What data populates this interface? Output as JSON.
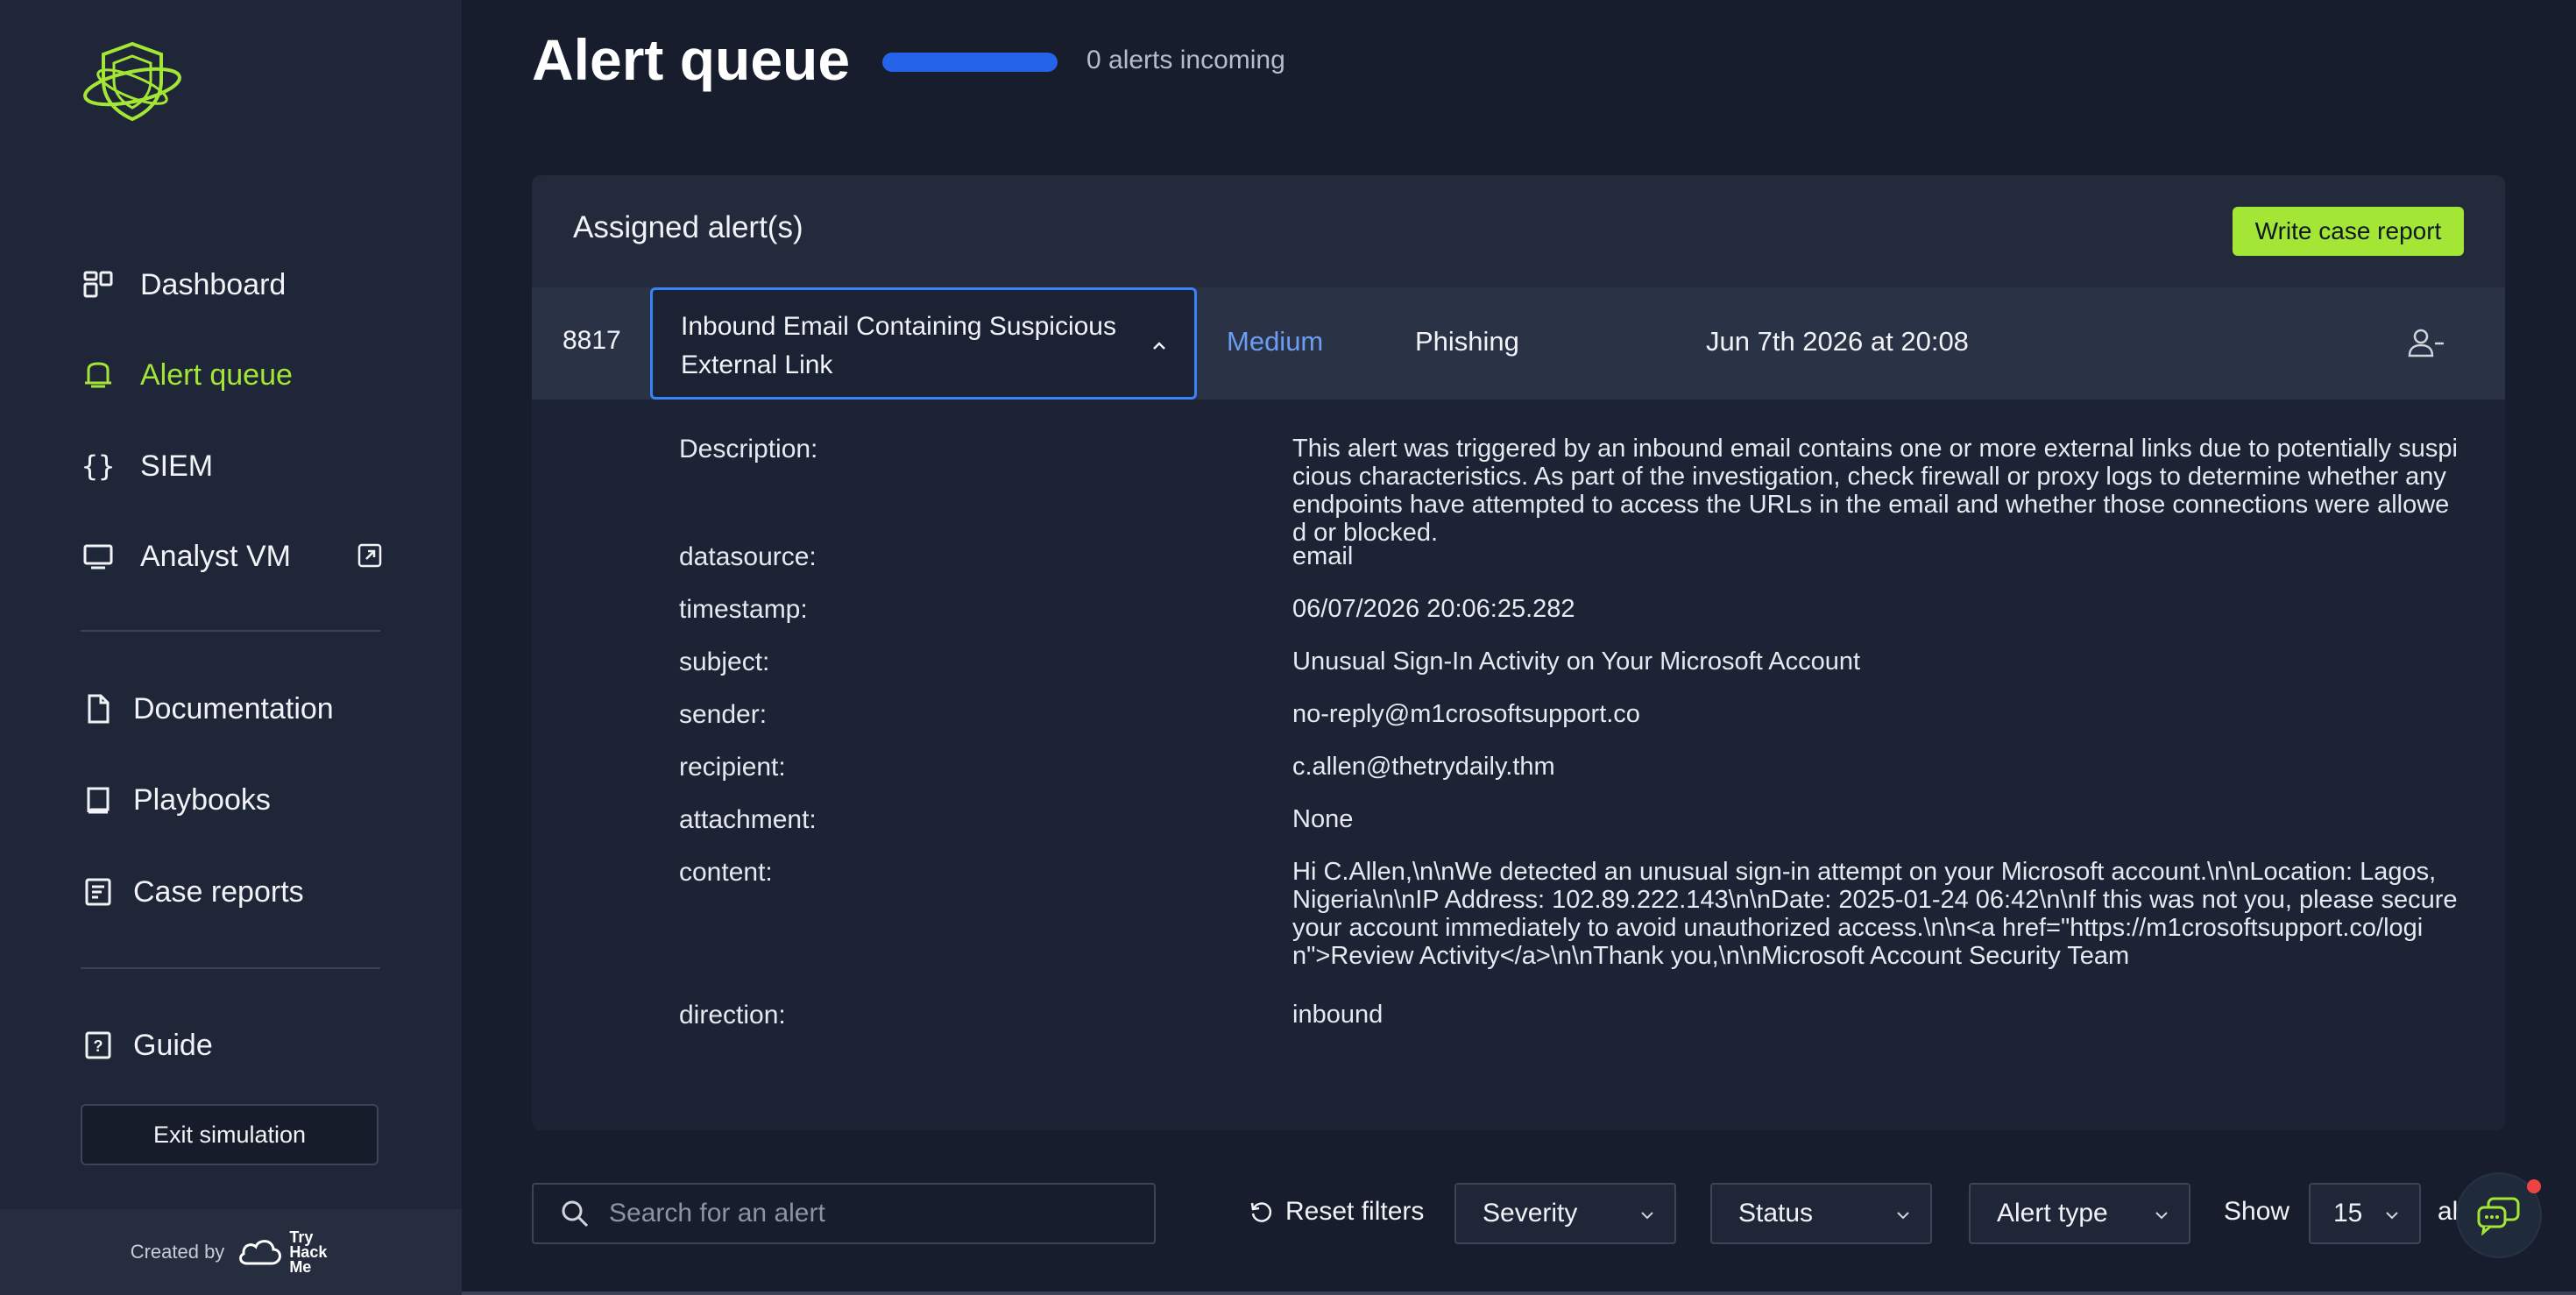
{
  "sidebar": {
    "nav": [
      {
        "label": "Dashboard",
        "icon": "dashboard-icon"
      },
      {
        "label": "Alert queue",
        "icon": "alert-queue-icon",
        "active": true
      },
      {
        "label": "SIEM",
        "icon": "braces-icon"
      },
      {
        "label": "Analyst VM",
        "icon": "monitor-icon"
      }
    ],
    "resources": [
      {
        "label": "Documentation",
        "icon": "document-icon"
      },
      {
        "label": "Playbooks",
        "icon": "book-icon"
      },
      {
        "label": "Case reports",
        "icon": "case-report-icon"
      }
    ],
    "guide_label": "Guide",
    "exit_label": "Exit simulation",
    "created_by": "Created by",
    "brand": "Try Hack Me"
  },
  "header": {
    "title": "Alert queue",
    "progress": 1.0,
    "incoming_text": "0 alerts incoming"
  },
  "panel": {
    "title": "Assigned alert(s)",
    "write_report_label": "Write case report",
    "alert": {
      "id": "8817",
      "name": "Inbound Email Containing Suspicious External Link",
      "severity": "Medium",
      "type": "Phishing",
      "date": "Jun 7th 2026 at 20:08"
    },
    "details": [
      {
        "key": "Description:",
        "value": "This alert was triggered by an inbound email contains one or more external links due to potentially suspicious characteristics. As part of the investigation, check firewall or proxy logs to determine whether any endpoints have attempted to access the URLs in the email and whether those connections were allowed or blocked."
      },
      {
        "key": "datasource:",
        "value": "email"
      },
      {
        "key": "timestamp:",
        "value": "06/07/2026 20:06:25.282"
      },
      {
        "key": "subject:",
        "value": "Unusual Sign-In Activity on Your Microsoft Account"
      },
      {
        "key": "sender:",
        "value": "no-reply@m1crosoftsupport.co"
      },
      {
        "key": "recipient:",
        "value": "c.allen@thetrydaily.thm"
      },
      {
        "key": "attachment:",
        "value": "None"
      },
      {
        "key": "content:",
        "value": "Hi C.Allen,\\n\\nWe detected an unusual sign-in attempt on your Microsoft account.\\n\\nLocation: Lagos, Nigeria\\n\\nIP Address: 102.89.222.143\\n\\nDate: 2025-01-24 06:42\\n\\nIf this was not you, please secure your account immediately to avoid unauthorized access.\\n\\n<a href=\"https://m1crosoftsupport.co/login\">Review Activity</a>\\n\\nThank you,\\n\\nMicrosoft Account Security Team"
      },
      {
        "key": "direction:",
        "value": "inbound"
      }
    ]
  },
  "filters": {
    "search_placeholder": "Search for an alert",
    "reset_label": "Reset filters",
    "severity_label": "Severity",
    "status_label": "Status",
    "alert_type_label": "Alert type",
    "show_label": "Show",
    "show_value": "15",
    "trailing_text": "al"
  },
  "colors": {
    "accent": "#a3e635",
    "severity_medium": "#6d9cf3",
    "progress": "#2563eb"
  }
}
